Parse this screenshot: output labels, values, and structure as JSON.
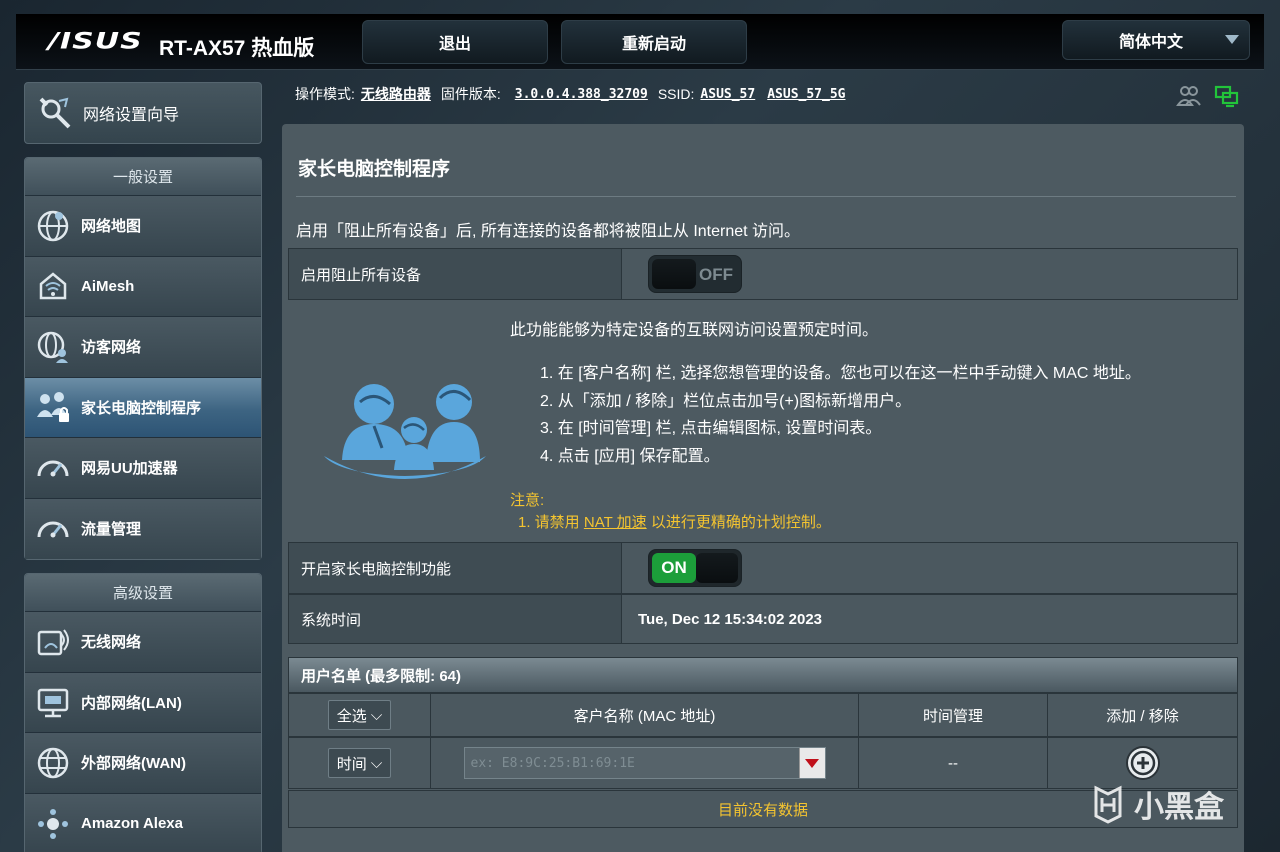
{
  "header": {
    "logo": "/ISUS",
    "model": "RT-AX57 热血版",
    "logout_label": "退出",
    "reboot_label": "重新启动",
    "language": "简体中文"
  },
  "infobar": {
    "mode_label": "操作模式:",
    "mode_value": "无线路由器",
    "firmware_label": "固件版本:",
    "firmware_value": "3.0.0.4.388_32709",
    "ssid_label": "SSID:",
    "ssid_1": "ASUS_57",
    "ssid_2": "ASUS_57_5G"
  },
  "sidebar": {
    "wizard": "网络设置向导",
    "general_header": "一般设置",
    "general_items": [
      {
        "label": "网络地图",
        "icon": "globe-map-icon"
      },
      {
        "label": "AiMesh",
        "icon": "aimesh-icon"
      },
      {
        "label": "访客网络",
        "icon": "guest-network-icon"
      },
      {
        "label": "家长电脑控制程序",
        "icon": "parental-control-icon"
      },
      {
        "label": "网易UU加速器",
        "icon": "speedometer-icon"
      },
      {
        "label": "流量管理",
        "icon": "speedometer-icon"
      }
    ],
    "advanced_header": "高级设置",
    "advanced_items": [
      {
        "label": "无线网络",
        "icon": "wireless-icon"
      },
      {
        "label": "内部网络(LAN)",
        "icon": "lan-icon"
      },
      {
        "label": "外部网络(WAN)",
        "icon": "wan-globe-icon"
      },
      {
        "label": "Amazon Alexa",
        "icon": "alexa-icon"
      }
    ]
  },
  "main": {
    "title": "家长电脑控制程序",
    "description": "启用「阻止所有设备」后, 所有连接的设备都将被阻止从 Internet 访问。",
    "block_all_label": "启用阻止所有设备",
    "block_all_state": "OFF",
    "intro": "此功能能够为特定设备的互联网访问设置预定时间。",
    "steps": [
      "1. 在 [客户名称] 栏, 选择您想管理的设备。您也可以在这一栏中手动键入 MAC 地址。",
      "2. 从「添加 / 移除」栏位点击加号(+)图标新增用户。",
      "3. 在 [时间管理] 栏, 点击编辑图标, 设置时间表。",
      "4. 点击 [应用] 保存配置。"
    ],
    "note_title": "注意:",
    "note_prefix": "1. 请禁用 ",
    "note_link": "NAT 加速",
    "note_suffix": " 以进行更精确的计划控制。",
    "enable_label": "开启家长电脑控制功能",
    "enable_state": "ON",
    "systime_label": "系统时间",
    "systime_value": "Tue, Dec 12 15:34:02 2023"
  },
  "client_table": {
    "title": "用户名单 (最多限制: 64)",
    "select_all": "全选",
    "col_client": "客户名称 (MAC 地址)",
    "col_time": "时间管理",
    "col_add": "添加 / 移除",
    "row_select": "时间",
    "mac_placeholder": "ex: E8:9C:25:B1:69:1E",
    "time_value": "--",
    "no_data": "目前没有数据"
  },
  "watermark": "小黑盒",
  "colors": {
    "accent_active": "#3d6482",
    "toggle_on": "#1c9e3a",
    "note_yellow": "#f4c430"
  }
}
